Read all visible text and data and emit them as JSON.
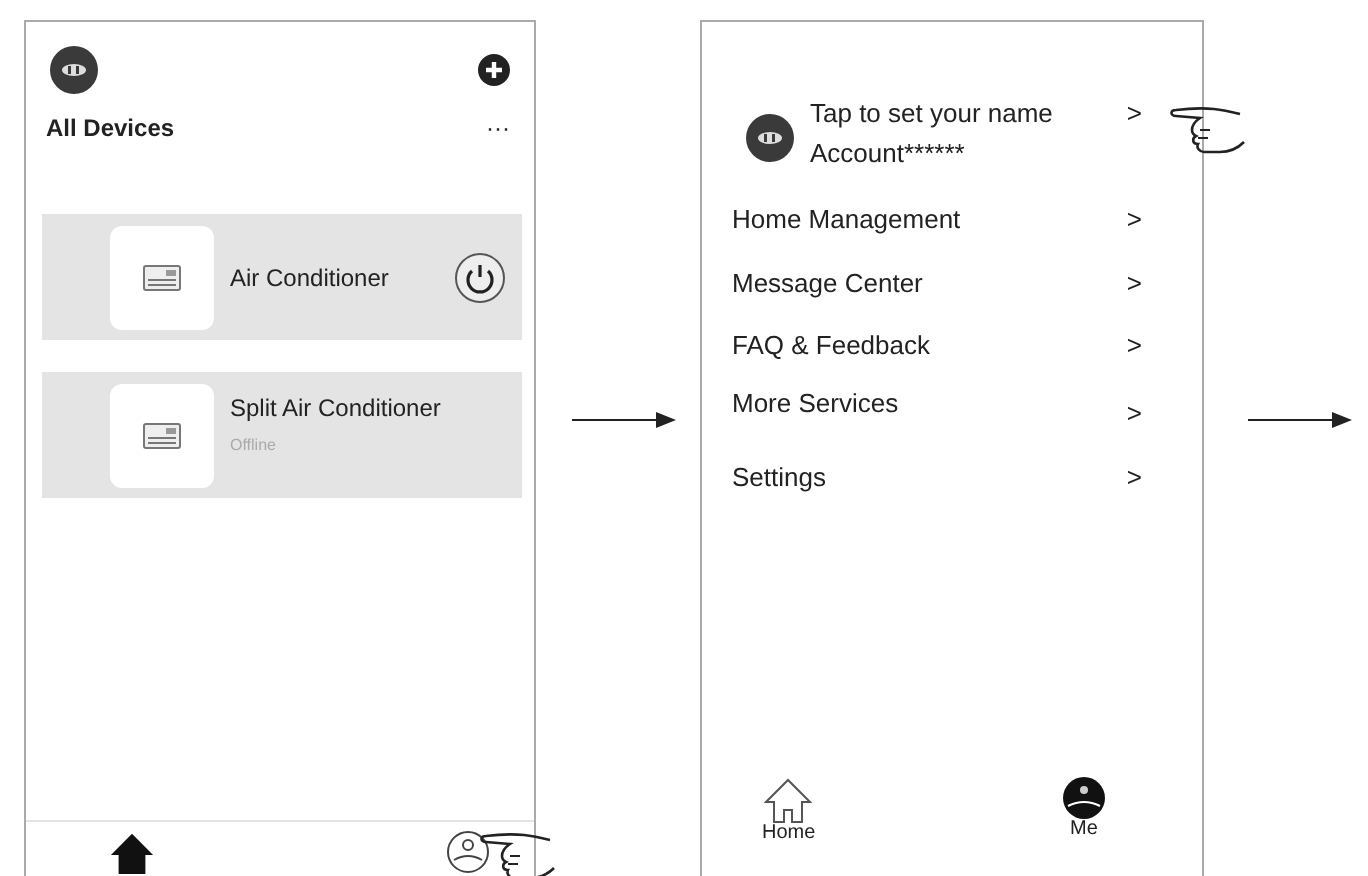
{
  "screens": [
    {
      "kind": "devices",
      "header": {
        "title": "All Devices",
        "more": "···"
      },
      "devices": [
        {
          "name": "Air Conditioner",
          "online": true
        },
        {
          "name": "Split Air Conditioner",
          "online": false,
          "status": "Offline"
        }
      ],
      "tabs": [
        {
          "selected": true
        },
        {
          "selected": false
        }
      ]
    },
    {
      "kind": "me",
      "profile": {
        "name": "Tap to set your name",
        "account": "Account******",
        "chevron": ">"
      },
      "menu": [
        {
          "label": "Home Management",
          "chevron": ">"
        },
        {
          "label": "Message Center",
          "chevron": ">"
        },
        {
          "label": "FAQ & Feedback",
          "chevron": ">"
        },
        {
          "label": "More Services",
          "chevron": ">"
        },
        {
          "label": "Settings",
          "chevron": ">"
        }
      ],
      "tabs": [
        {
          "label": "Home",
          "selected": false
        },
        {
          "label": "Me",
          "selected": true
        }
      ]
    }
  ]
}
